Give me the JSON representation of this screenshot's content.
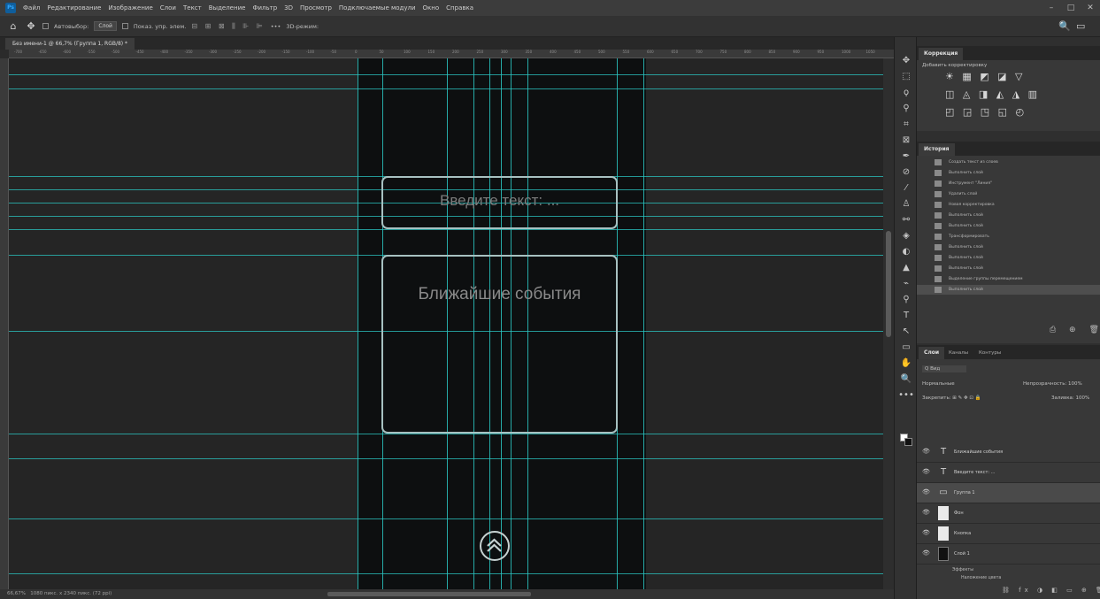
{
  "app": {
    "logo_text": "Ps"
  },
  "menu": {
    "items": [
      "Файл",
      "Редактирование",
      "Изображение",
      "Слои",
      "Текст",
      "Выделение",
      "Фильтр",
      "3D",
      "Просмотр",
      "Подключаемые модули",
      "Окно",
      "Справка"
    ]
  },
  "window_controls": {
    "minimize": "–",
    "maximize": "□",
    "close": "✕"
  },
  "options_bar": {
    "autoselect_label": "Автовыбор:",
    "autoselect_value": "Слой",
    "transform_label": "Показ. упр. элем.",
    "align_glyphs": "⊟ ⊞ ⊠ ⫼ ⊪ ⊫",
    "more": "•••",
    "mode_3d": "3D-режим:",
    "right_search": "🔍",
    "right_ws": "▭"
  },
  "document": {
    "tab_title": "Без имени-1 @ 66,7% (Группа 1, RGB/8) *"
  },
  "ruler_ticks": [
    "-700",
    "-650",
    "-600",
    "-550",
    "-500",
    "-450",
    "-400",
    "-350",
    "-300",
    "-250",
    "-200",
    "-150",
    "-100",
    "-50",
    "0",
    "50",
    "100",
    "150",
    "200",
    "250",
    "300",
    "350",
    "400",
    "450",
    "500",
    "550",
    "600",
    "650",
    "700",
    "750",
    "800",
    "850",
    "900",
    "950",
    "1000",
    "1050"
  ],
  "canvas": {
    "text_input_placeholder": "Введите текст: ...",
    "events_title": "Ближайшие события",
    "scroll_up_icon": "double-chevron-up-icon"
  },
  "status_bar": {
    "zoom": "66,67%",
    "doc_info": "1080 пикс. x 2340 пикс. (72 ppi)"
  },
  "tools": [
    "✥",
    "⬚",
    "ϙ",
    "⚲",
    "⌗",
    "⊠",
    "✒",
    "⊘",
    "⁄",
    "♙",
    "⚯",
    "◈",
    "◐",
    "▲",
    "⌁",
    "⚲",
    "T",
    "↖",
    "▭",
    "✋",
    "🔍",
    "•••"
  ],
  "properties_panel": {
    "tab": "Коррекция",
    "add_label": "Добавить корректировку",
    "row1": "☀ ▦ ◩ ◪ ▽",
    "row2": "◫ ◬ ◨ ◭ ◮ ▥",
    "row3": "◰ ◲ ◳ ◱ ◴"
  },
  "history_panel": {
    "tab": "История",
    "items": [
      "Создать текст из слоев",
      "Выполнить слой",
      "Инструмент \"Линия\"",
      "Удалить слой",
      "Новая корректировка",
      "Выполнить слой",
      "Выполнить слой",
      "Трансформировать",
      "Выполнить слой",
      "Выполнить слой",
      "Выполнить слой",
      "Выделение группы перемещением",
      "Выполнить слой"
    ],
    "footer": "⎙ ⊕ 🗑"
  },
  "layers_panel": {
    "tabs": [
      "Слои",
      "Каналы",
      "Контуры"
    ],
    "filter_label": "Q Вид",
    "blend_mode": "Нормальные",
    "opacity_label": "Непрозрачность: 100%",
    "lock_label": "Закрепить: ⊞ ✎ ✥ ⊡ 🔒",
    "fill_label": "Заливка: 100%",
    "layers": [
      {
        "name": "Ближайшие события",
        "type": "text"
      },
      {
        "name": "Введите текст: ...",
        "type": "text"
      },
      {
        "name": "Группа 1",
        "type": "group"
      },
      {
        "name": "Фон",
        "type": "image"
      },
      {
        "name": "Кнопка",
        "type": "image"
      },
      {
        "name": "Слой 1",
        "type": "dark"
      }
    ],
    "fx_label": "Эффекты",
    "fx_item": "Наложение цвета",
    "footer": "⛓ fx ◑ ◧ ▭ ⊕ 🗑"
  },
  "colors": {
    "guide": "#2bc6c2",
    "artboard": "#0d0f10",
    "box_border": "#a7c1c1"
  }
}
